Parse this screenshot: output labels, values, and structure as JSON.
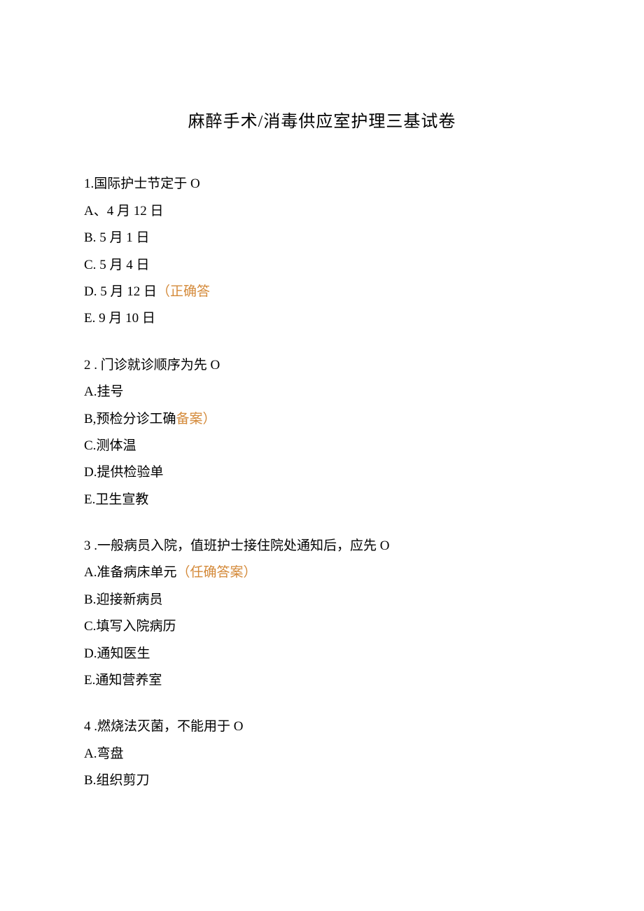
{
  "title": "麻醉手术/消毒供应室护理三基试卷",
  "questions": [
    {
      "stem_prefix": "1.",
      "stem_text": "国际护士节定于 O",
      "options": [
        {
          "letter": "A、",
          "text": "4 月 12 日",
          "answer": ""
        },
        {
          "letter": "B.",
          "text": "5 月 1 日",
          "answer": ""
        },
        {
          "letter": "C.",
          "text": "5 月 4 日",
          "answer": ""
        },
        {
          "letter": "D.",
          "text": "5 月 12 日",
          "answer": "（正确答"
        },
        {
          "letter": "E.",
          "text": "9 月 10 日",
          "answer": ""
        }
      ]
    },
    {
      "stem_prefix": "2",
      "stem_text": " . 门诊就诊顺序为先 O",
      "options": [
        {
          "letter": "A.",
          "text": "挂号",
          "answer": ""
        },
        {
          "letter": "B,",
          "text": "预检分诊工确",
          "answer": "备案）"
        },
        {
          "letter": "C.",
          "text": "测体温",
          "answer": ""
        },
        {
          "letter": "D.",
          "text": "提供检验单",
          "answer": ""
        },
        {
          "letter": "E.",
          "text": "卫生宣教",
          "answer": ""
        }
      ]
    },
    {
      "stem_prefix": "3",
      "stem_text": " .一般病员入院，值班护士接住院处通知后，应先 O",
      "options": [
        {
          "letter": "A.",
          "text": "准备病床单元",
          "answer": "（任确答案）"
        },
        {
          "letter": "B.",
          "text": "迎接新病员",
          "answer": ""
        },
        {
          "letter": "C.",
          "text": "填写入院病历",
          "answer": ""
        },
        {
          "letter": "D.",
          "text": "通知医生",
          "answer": ""
        },
        {
          "letter": "E.",
          "text": "通知营养室",
          "answer": ""
        }
      ]
    },
    {
      "stem_prefix": "4",
      "stem_text": " .燃烧法灭菌，不能用于 O",
      "options": [
        {
          "letter": "A.",
          "text": "弯盘",
          "answer": ""
        },
        {
          "letter": "B.",
          "text": "组织剪刀",
          "answer": ""
        }
      ]
    }
  ]
}
